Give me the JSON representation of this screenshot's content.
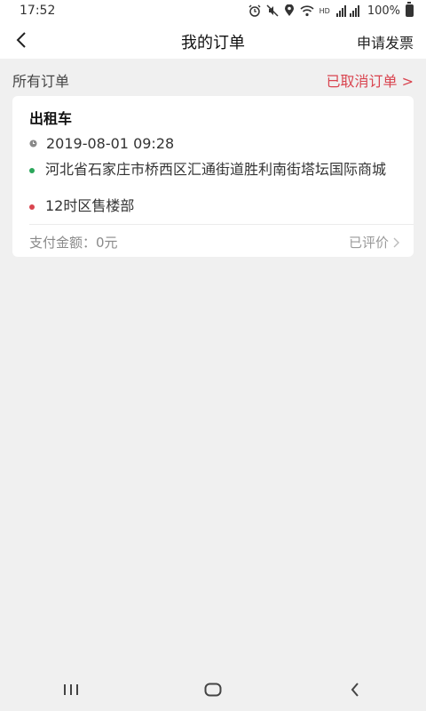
{
  "status": {
    "time": "17:52",
    "battery": "100%",
    "network_label": "HD"
  },
  "nav": {
    "title": "我的订单",
    "action": "申请发票"
  },
  "section": {
    "label": "所有订单",
    "cancelled_link": "已取消订单 >"
  },
  "order": {
    "type": "出租车",
    "datetime": "2019-08-01 09:28",
    "from": "河北省石家庄市桥西区汇通街道胜利南街塔坛国际商城",
    "to": "12时区售楼部",
    "payment": "支付金额：0元",
    "status": "已评价"
  },
  "colors": {
    "accent_red": "#d9444f",
    "start_green": "#2aa65a"
  }
}
